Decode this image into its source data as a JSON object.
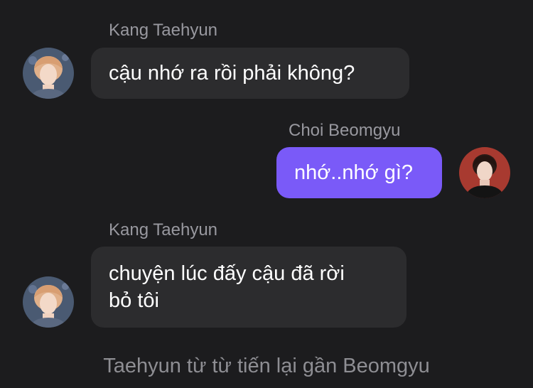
{
  "messages": [
    {
      "sender": "Kang Taehyun",
      "text": "cậu nhớ ra rồi phải không?",
      "direction": "incoming",
      "avatar": "avatar-taehyun"
    },
    {
      "sender": "Choi Beomgyu",
      "text": "nhớ..nhớ gì?",
      "direction": "outgoing",
      "avatar": "avatar-beomgyu"
    },
    {
      "sender": "Kang Taehyun",
      "text_line1": "chuyện lúc đấy cậu đã rời",
      "text_line2": "bỏ tôi",
      "direction": "incoming",
      "avatar": "avatar-taehyun"
    }
  ],
  "narration": "Taehyun từ từ tiến lại gần Beomgyu",
  "colors": {
    "background": "#1c1c1e",
    "incoming_bubble": "#2c2c2e",
    "outgoing_bubble": "#7a5af8",
    "sender_label": "#98989f",
    "narration": "#8e8e93"
  }
}
